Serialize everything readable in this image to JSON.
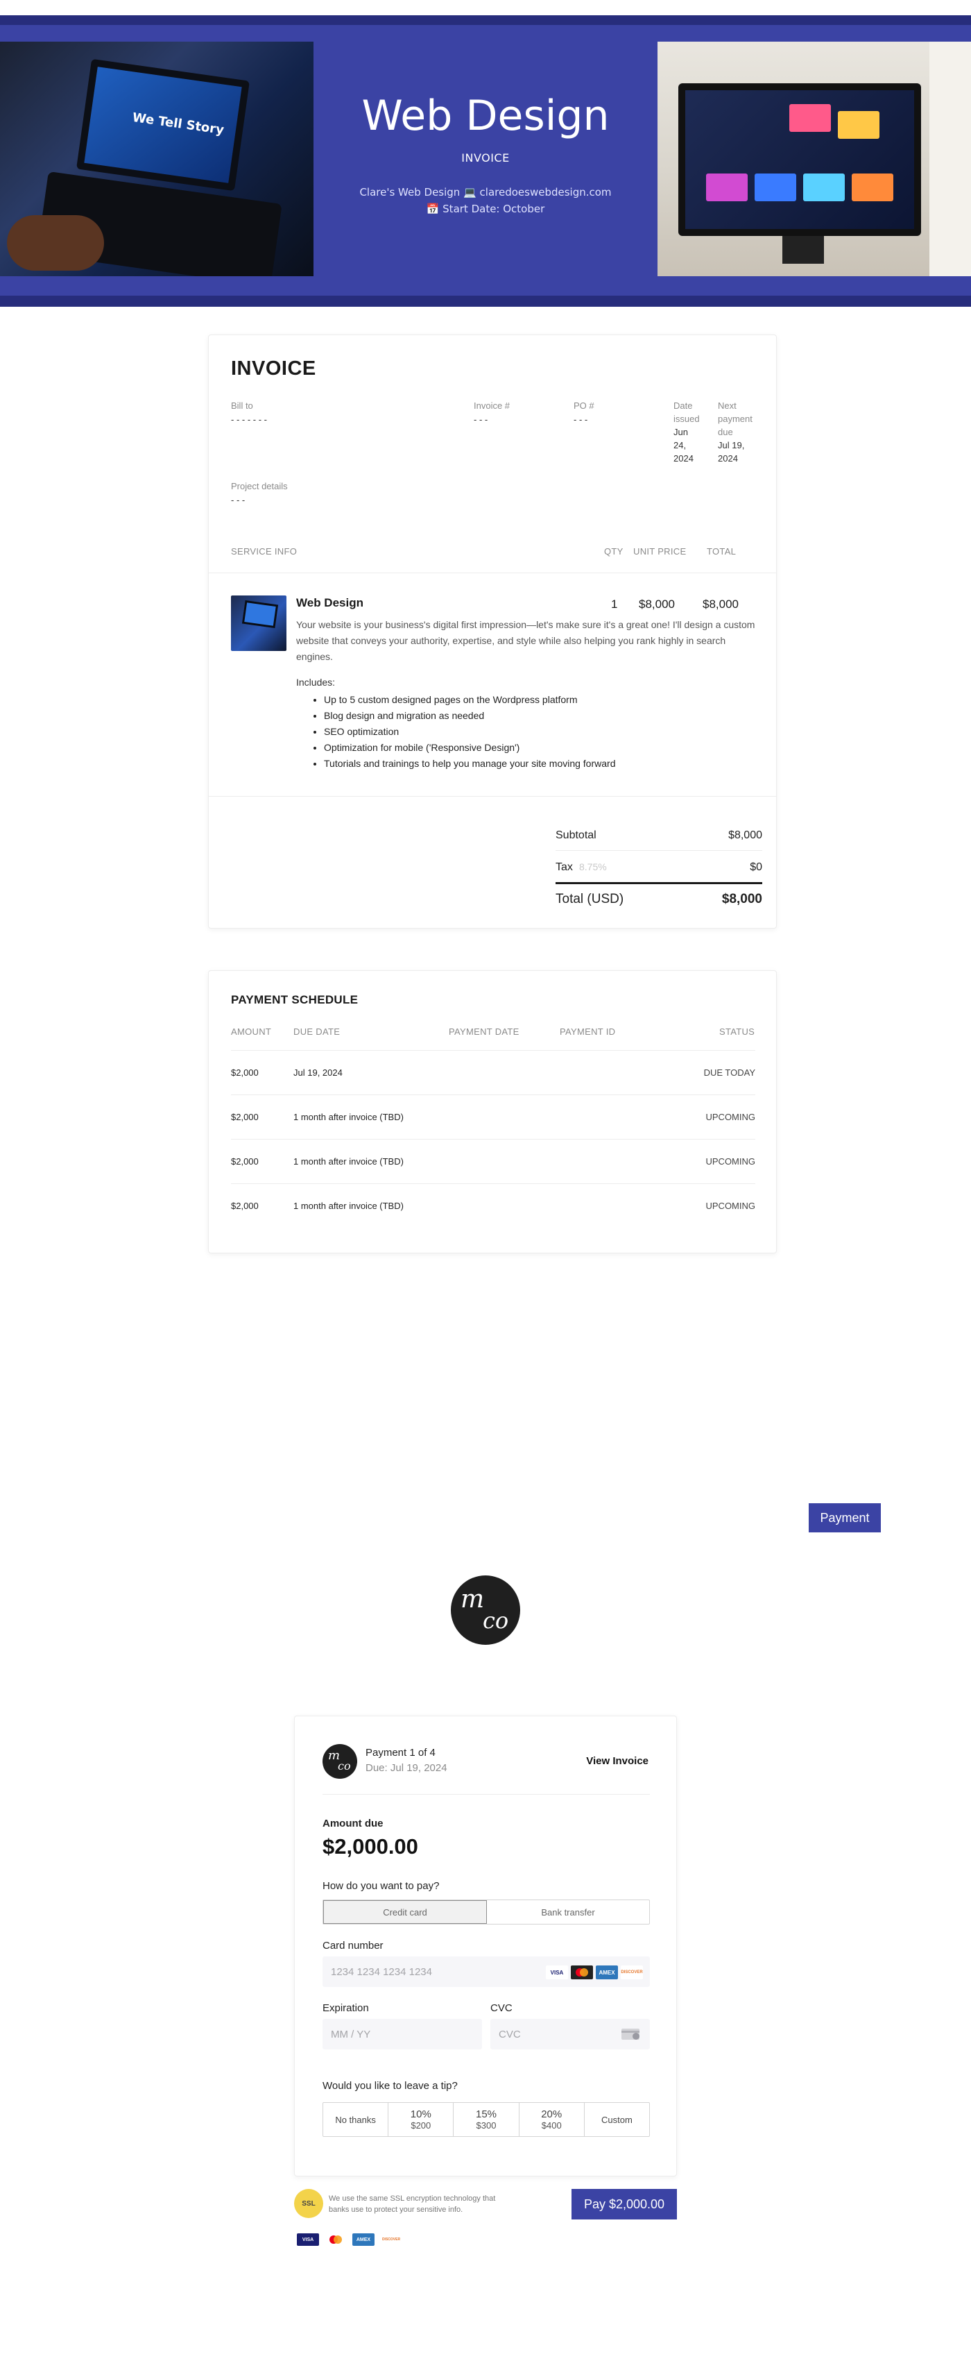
{
  "colors": {
    "brand": "#3b43a4",
    "brand_dark": "#272d7c",
    "text": "#1a1a1a",
    "muted": "#8a8a8a"
  },
  "banner": {
    "title": "Web Design",
    "subtitle": "INVOICE",
    "line1": "Clare's Web Design 💻 claredoeswebdesign.com",
    "line2": "📅 Start Date: October",
    "photo_left_text": "We Tell Story"
  },
  "invoice": {
    "title": "INVOICE",
    "bill_to_label": "Bill to",
    "bill_to_value": "- - - - - - -",
    "invoice_no_label": "Invoice #",
    "invoice_no_value": "- - -",
    "po_label": "PO #",
    "po_value": "- - -",
    "date_issued_label_1": "Date",
    "date_issued_label_2": "issued",
    "date_issued_value_1": "Jun",
    "date_issued_value_2": "24,",
    "date_issued_value_3": "2024",
    "next_due_label_1": "Next",
    "next_due_label_2": "payment",
    "next_due_label_3": "due",
    "next_due_value_1": "Jul 19,",
    "next_due_value_2": "2024",
    "project_label": "Project details",
    "project_value": "- - -",
    "columns": {
      "service": "SERVICE INFO",
      "qty": "QTY",
      "unit_price": "UNIT PRICE",
      "total": "TOTAL"
    },
    "item": {
      "title": "Web Design",
      "qty": "1",
      "unit_price": "$8,000",
      "total": "$8,000",
      "description": "Your website is your business's digital first impression—let's make sure it's a great one! I'll design a custom website that conveys your authority, expertise, and style while also helping you rank highly in search engines.",
      "includes_label": "Includes:",
      "includes": [
        "Up to 5 custom designed pages on the Wordpress platform",
        "Blog design and migration as needed",
        "SEO optimization",
        "Optimization for mobile ('Responsive Design')",
        "Tutorials and trainings to help you manage your site moving forward"
      ]
    },
    "subtotal_label": "Subtotal",
    "subtotal_value": "$8,000",
    "tax_label": "Tax",
    "tax_rate": "8.75%",
    "tax_value": "$0",
    "total_label": "Total (USD)",
    "total_value": "$8,000"
  },
  "schedule": {
    "title": "PAYMENT SCHEDULE",
    "columns": {
      "amount": "AMOUNT",
      "due_date": "DUE DATE",
      "payment_date": "PAYMENT DATE",
      "payment_id": "PAYMENT ID",
      "status": "STATUS"
    },
    "rows": [
      {
        "amount": "$2,000",
        "due": "Jul 19, 2024",
        "status": "DUE TODAY"
      },
      {
        "amount": "$2,000",
        "due": "1 month after invoice (TBD)",
        "status": "UPCOMING"
      },
      {
        "amount": "$2,000",
        "due": "1 month after invoice (TBD)",
        "status": "UPCOMING"
      },
      {
        "amount": "$2,000",
        "due": "1 month after invoice (TBD)",
        "status": "UPCOMING"
      }
    ]
  },
  "payment_button": "Payment",
  "logo": {
    "m": "m",
    "co": "co"
  },
  "checkout": {
    "payment_of": "Payment 1 of 4",
    "due": "Due: Jul 19, 2024",
    "view_invoice": "View Invoice",
    "amount_due_label": "Amount due",
    "amount_due": "$2,000.00",
    "how_label": "How do you want to pay?",
    "method_card": "Credit card",
    "method_bank": "Bank transfer",
    "card_number_label": "Card number",
    "card_number_placeholder": "1234 1234 1234 1234",
    "expiration_label": "Expiration",
    "expiration_placeholder": "MM / YY",
    "cvc_label": "CVC",
    "cvc_placeholder": "CVC",
    "tip_label": "Would you like to leave a tip?",
    "tips": [
      {
        "pct": "No thanks",
        "amt": ""
      },
      {
        "pct": "10%",
        "amt": "$200"
      },
      {
        "pct": "15%",
        "amt": "$300"
      },
      {
        "pct": "20%",
        "amt": "$400"
      },
      {
        "pct": "Custom",
        "amt": ""
      }
    ],
    "card_brands": [
      "VISA",
      "MC",
      "AMEX",
      "DISCOVER"
    ]
  },
  "footer": {
    "ssl_badge": "SSL",
    "ssl_text": "We use the same SSL encryption technology that banks use to protect your sensitive info.",
    "pay_button": "Pay $2,000.00",
    "card_brands": [
      "VISA",
      "MC",
      "AMEX",
      "DISCOVER"
    ]
  }
}
